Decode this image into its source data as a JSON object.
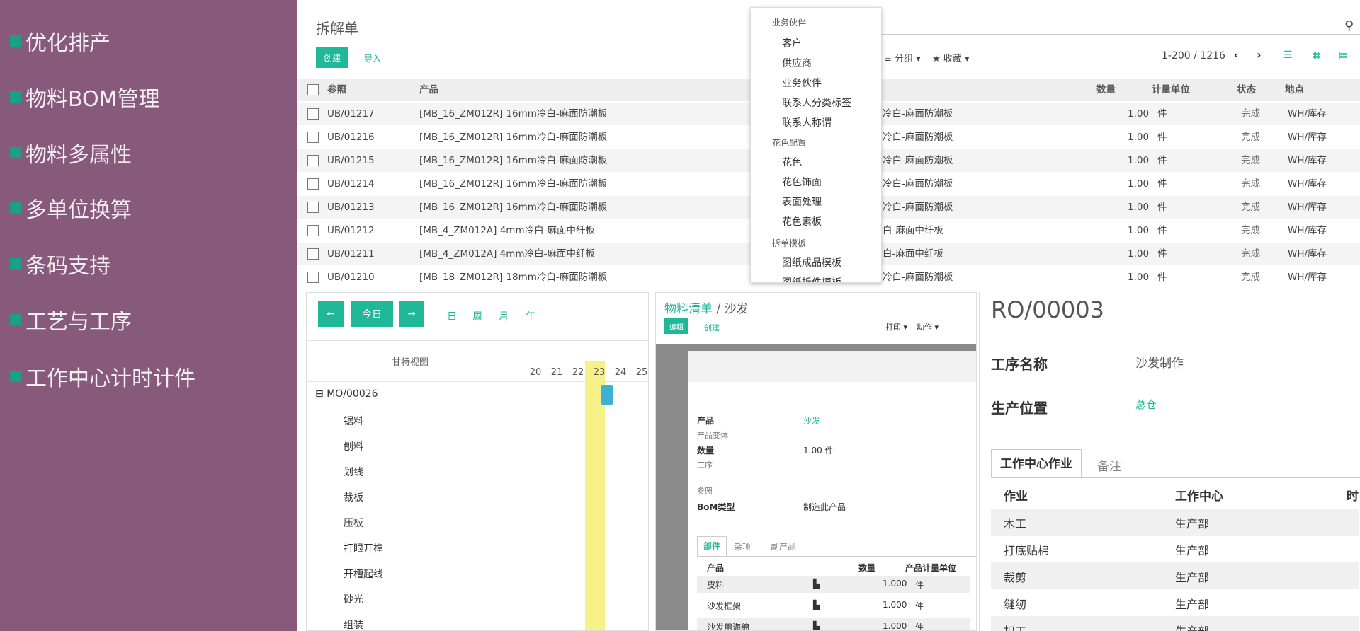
{
  "sidebar": {
    "features": [
      "优化排产",
      "物料BOM管理",
      "物料多属性",
      "多单位换算",
      "条码支持",
      "工艺与工序",
      "工作中心计时计件"
    ]
  },
  "unbuild": {
    "title": "拆解单",
    "create_label": "创建",
    "import_label": "导入",
    "group_by_label": "分组",
    "favorites_label": "收藏",
    "pager": "1-200 / 1216",
    "columns": {
      "ref": "参照",
      "product": "产品",
      "qty": "数量",
      "uom": "计量单位",
      "state": "状态",
      "location": "地点"
    },
    "rows": [
      {
        "ref": "UB/01217",
        "product": "[MB_16_ZM012R] 16mm冷白-麻面防潮板",
        "product_right": "冷白-麻面防潮板",
        "qty": "1.00",
        "uom": "件",
        "state": "完成",
        "location": "WH/库存"
      },
      {
        "ref": "UB/01216",
        "product": "[MB_16_ZM012R] 16mm冷白-麻面防潮板",
        "product_right": "冷白-麻面防潮板",
        "qty": "1.00",
        "uom": "件",
        "state": "完成",
        "location": "WH/库存"
      },
      {
        "ref": "UB/01215",
        "product": "[MB_16_ZM012R] 16mm冷白-麻面防潮板",
        "product_right": "冷白-麻面防潮板",
        "qty": "1.00",
        "uom": "件",
        "state": "完成",
        "location": "WH/库存"
      },
      {
        "ref": "UB/01214",
        "product": "[MB_16_ZM012R] 16mm冷白-麻面防潮板",
        "product_right": "冷白-麻面防潮板",
        "qty": "1.00",
        "uom": "件",
        "state": "完成",
        "location": "WH/库存"
      },
      {
        "ref": "UB/01213",
        "product": "[MB_16_ZM012R] 16mm冷白-麻面防潮板",
        "product_right": "冷白-麻面防潮板",
        "qty": "1.00",
        "uom": "件",
        "state": "完成",
        "location": "WH/库存"
      },
      {
        "ref": "UB/01212",
        "product": "[MB_4_ZM012A] 4mm冷白-麻面中纤板",
        "product_right": "白-麻面中纤板",
        "qty": "1.00",
        "uom": "件",
        "state": "完成",
        "location": "WH/库存"
      },
      {
        "ref": "UB/01211",
        "product": "[MB_4_ZM012A] 4mm冷白-麻面中纤板",
        "product_right": "白-麻面中纤板",
        "qty": "1.00",
        "uom": "件",
        "state": "完成",
        "location": "WH/库存"
      },
      {
        "ref": "UB/01210",
        "product": "[MB_18_ZM012R] 18mm冷白-麻面防潮板",
        "product_right": "冷白-麻面防潮板",
        "qty": "1.00",
        "uom": "件",
        "state": "完成",
        "location": "WH/库存"
      }
    ]
  },
  "dropdown": {
    "groups": [
      {
        "head": "业务伙伴",
        "items": [
          "客户",
          "供应商",
          "业务伙伴",
          "联系人分类标签",
          "联系人称谓"
        ]
      },
      {
        "head": "花色配置",
        "items": [
          "花色",
          "花色饰面",
          "表面处理",
          "花色素板"
        ]
      },
      {
        "head": "拆单模板",
        "items": [
          "图纸成品模板",
          "图纸拆件模板"
        ]
      }
    ]
  },
  "gantt": {
    "prev_label": "←",
    "today_label": "今日",
    "next_label": "→",
    "scales": [
      "日",
      "周",
      "月",
      "年"
    ],
    "view_title": "甘特视图",
    "days": [
      "20",
      "21",
      "22",
      "23",
      "24",
      "25"
    ],
    "order": "MO/00026",
    "tasks": [
      "锯料",
      "刨料",
      "划线",
      "裁板",
      "压板",
      "打眼开榫",
      "开槽起线",
      "砂光",
      "组装"
    ]
  },
  "bom": {
    "breadcrumb_parent": "物料清单",
    "breadcrumb_sep": "/",
    "breadcrumb_current": "沙发",
    "edit_label": "编辑",
    "create_label": "创建",
    "print_label": "打印",
    "action_label": "动作",
    "fields": {
      "product_label": "产品",
      "product_value": "沙发",
      "variant_label": "产品变体",
      "qty_label": "数量",
      "qty_value": "1.00 件",
      "routing_label": "工序",
      "ref_label": "参照",
      "type_label": "BoM类型",
      "type_value": "制造此产品"
    },
    "tabs": [
      "部件",
      "杂项",
      "副产品"
    ],
    "columns": {
      "product": "产品",
      "qty": "数量",
      "uom": "产品计量单位"
    },
    "lines": [
      {
        "product": "皮料",
        "qty": "1.000",
        "uom": "件"
      },
      {
        "product": "沙发框架",
        "qty": "1.000",
        "uom": "件"
      },
      {
        "product": "沙发用海绵",
        "qty": "1.000",
        "uom": "件"
      }
    ]
  },
  "routing": {
    "title": "RO/00003",
    "name_label": "工序名称",
    "name_value": "沙发制作",
    "location_label": "生产位置",
    "location_value": "总仓",
    "tabs": [
      "工作中心作业",
      "备注"
    ],
    "columns": {
      "op": "作业",
      "wc": "工作中心",
      "time": "时"
    },
    "ops": [
      {
        "op": "木工",
        "wc": "生产部"
      },
      {
        "op": "打底贴棉",
        "wc": "生产部"
      },
      {
        "op": "裁剪",
        "wc": "生产部"
      },
      {
        "op": "缝纫",
        "wc": "生产部"
      },
      {
        "op": "扣工",
        "wc": "生产部"
      }
    ]
  }
}
